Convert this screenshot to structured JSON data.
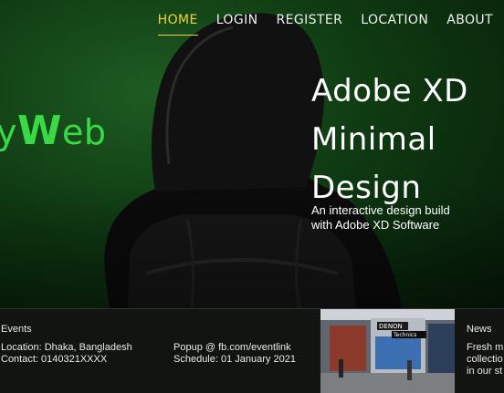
{
  "nav": {
    "items": [
      {
        "label": "HOME"
      },
      {
        "label": "LOGIN"
      },
      {
        "label": "REGISTER"
      },
      {
        "label": "LOCATION"
      },
      {
        "label": "ABOUT"
      }
    ]
  },
  "brand": {
    "prefix": "y",
    "big": "W",
    "suffix": "eb"
  },
  "hero": {
    "title_line1": "Adobe XD",
    "title_line2": "Minimal",
    "title_line3": "Design",
    "subtitle_line1": "An interactive design build",
    "subtitle_line2": "with Adobe XD Software"
  },
  "events": {
    "title": "Events",
    "location": "Location: Dhaka, Bangladesh",
    "contact": "Contact: 0140321XXXX",
    "popup": "Popup @ fb.com/eventlink",
    "schedule": "Schedule: 01 January 2021"
  },
  "photo_signs": {
    "sign1": "DENON",
    "sign2": "Technics"
  },
  "news": {
    "title": "News",
    "line1": "Fresh m",
    "line2": "collectio",
    "line3": "in our st"
  },
  "colors": {
    "accent": "#f2d23a",
    "brand": "#39d948",
    "hero_bg": "#0f3a12"
  }
}
